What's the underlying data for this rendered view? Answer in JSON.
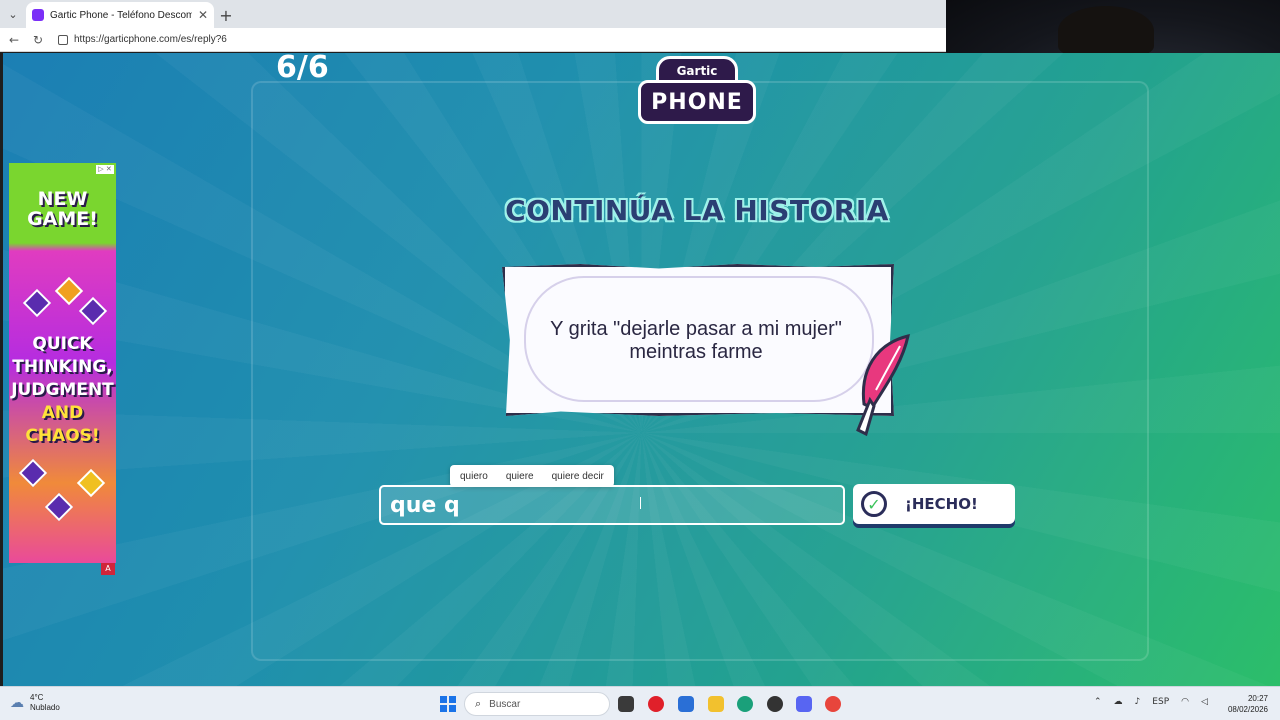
{
  "browser": {
    "tab_title": "Gartic Phone - Teléfono Descomp",
    "url": "https://garticphone.com/es/reply?6"
  },
  "game": {
    "round": "6/6",
    "logo_top": "Gartic",
    "logo_main": "PHONE",
    "heading": "CONTINÚA LA HISTORIA",
    "story_text": "Y grita \"dejarle pasar a mi mujer\" meintras farme",
    "input_value": "que q",
    "suggestions": [
      "quiero",
      "quiere",
      "quiere decir"
    ],
    "done_label": "¡HECHO!"
  },
  "ad": {
    "headline": "NEW GAME!",
    "tagline_1": "QUICK",
    "tagline_2": "THINKING,",
    "tagline_3": "JUDGMENT",
    "tagline_4": "AND",
    "tagline_5": "CHAOS!",
    "badge": "A"
  },
  "taskbar": {
    "temperature": "4°C",
    "weather": "Nublado",
    "search_placeholder": "Buscar",
    "language": "ESP",
    "time": "20:27",
    "date": "08/02/2026"
  },
  "colors": {
    "heading_fill": "#2a3f73",
    "heading_outline": "#9ef2ea",
    "accent_check": "#3cc35b",
    "brand_dark": "#2e1a4a"
  }
}
